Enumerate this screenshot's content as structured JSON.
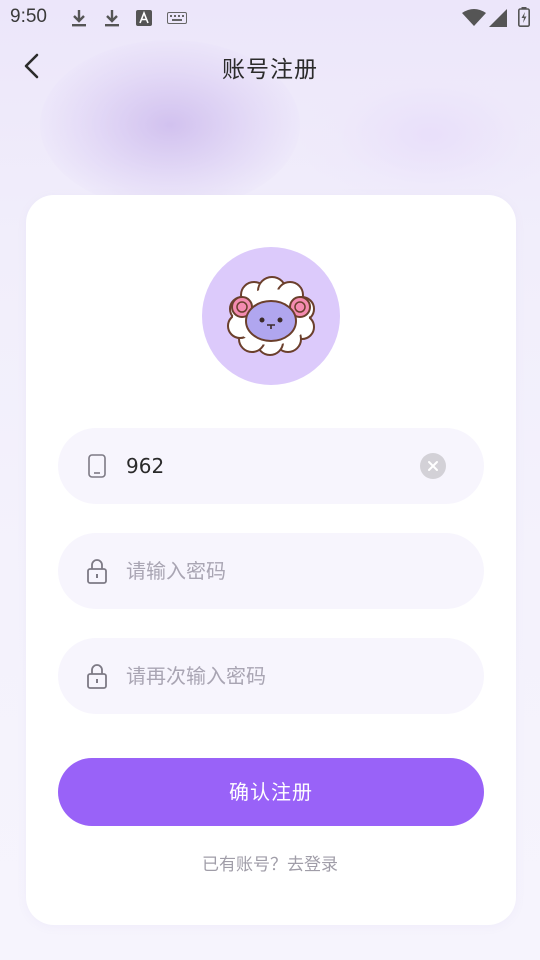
{
  "status_bar": {
    "time": "9:50",
    "left_icons": [
      "download-icon",
      "download-icon",
      "font-icon",
      "keyboard-icon"
    ],
    "right_icons": [
      "wifi-icon",
      "signal-icon",
      "battery-charging-icon"
    ]
  },
  "header": {
    "title": "账号注册",
    "back_icon": "chevron-left-icon"
  },
  "avatar": {
    "icon": "sheep-mascot",
    "background": "#dccafb"
  },
  "form": {
    "phone": {
      "value": "962",
      "icon": "phone-icon",
      "clear_icon": "close-icon"
    },
    "password": {
      "placeholder": "请输入密码",
      "icon": "lock-icon"
    },
    "confirm_password": {
      "placeholder": "请再次输入密码",
      "icon": "lock-icon"
    }
  },
  "submit_label": "确认注册",
  "login_link": "已有账号？去登录",
  "colors": {
    "accent": "#9962f8",
    "field_bg": "#f7f5fd",
    "card_bg": "#ffffff",
    "page_bg": "#f1eefb"
  }
}
